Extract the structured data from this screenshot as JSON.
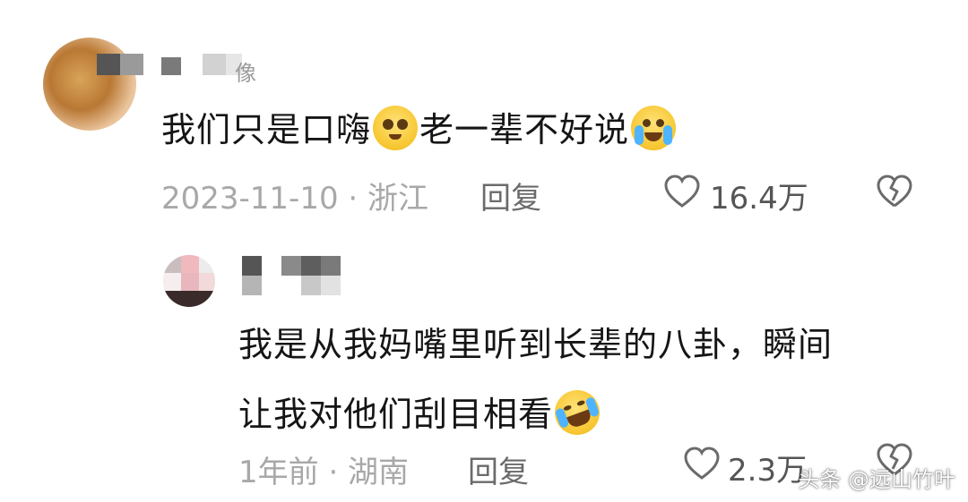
{
  "comments": [
    {
      "username": "像",
      "text_before": "我们只是口嗨",
      "text_middle": "老一辈不好说",
      "date_location": "2023-11-10 · 浙江",
      "reply_label": "回复",
      "like_count": "16.4万"
    },
    {
      "text_line1": "我是从我妈嘴里听到长辈的八卦，瞬间",
      "text_line2": "让我对他们刮目相看",
      "date_location": "1年前 · 湖南",
      "reply_label": "回复",
      "like_count": "2.3万"
    }
  ],
  "watermark": "头条 @远山竹叶",
  "icons": {
    "like": "heart-outline-icon",
    "dislike": "broken-heart-icon"
  }
}
